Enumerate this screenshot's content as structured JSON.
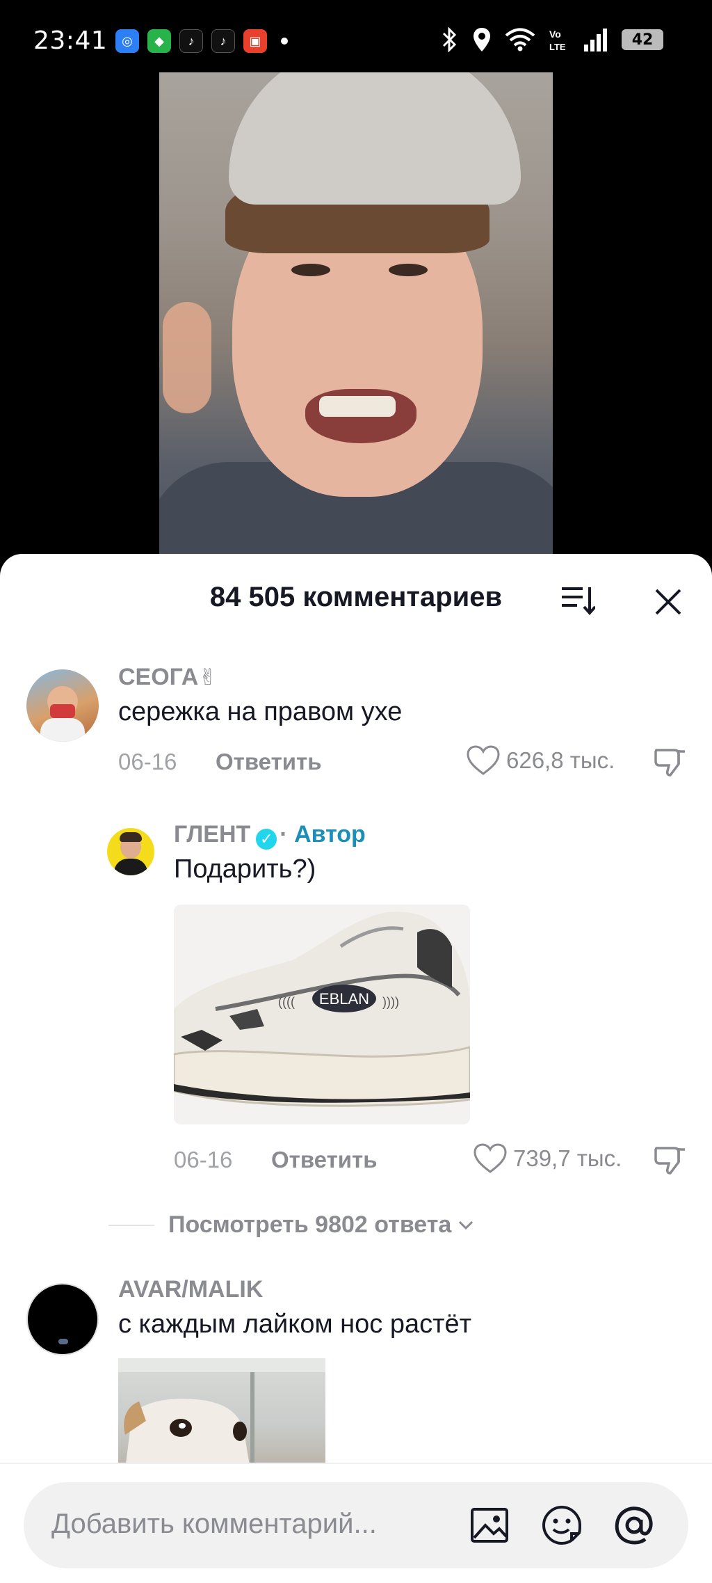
{
  "status_bar": {
    "time": "23:41",
    "battery": "42",
    "icons": [
      "bluetooth-icon",
      "location-icon",
      "wifi-icon",
      "volte-icon",
      "signal-icon",
      "battery-icon"
    ],
    "app_icons": [
      "browser-icon",
      "shield-app-icon",
      "tiktok-icon",
      "tiktok-icon",
      "app-icon"
    ]
  },
  "comments_panel": {
    "title": "84 505 комментариев"
  },
  "comments": [
    {
      "username": "СЕОГА",
      "text": "сережка на правом ухе",
      "date": "06-16",
      "reply_label": "Ответить",
      "likes": "626,8 тыс."
    },
    {
      "username": "ГЛЕНТ",
      "author_tag": "Автор",
      "text": "Подарить?)",
      "image_text": "EBLAN",
      "date": "06-16",
      "reply_label": "Ответить",
      "likes": "739,7 тыс."
    },
    {
      "username": "AVAR/MALIK",
      "text": "с каждым лайком нос растёт"
    }
  ],
  "view_replies": "Посмотреть 9802 ответа",
  "input": {
    "placeholder": "Добавить комментарий..."
  },
  "colors": {
    "author_accent": "#1c8fb8",
    "verified": "#20d5ec",
    "muted_text": "#8a8b91"
  }
}
